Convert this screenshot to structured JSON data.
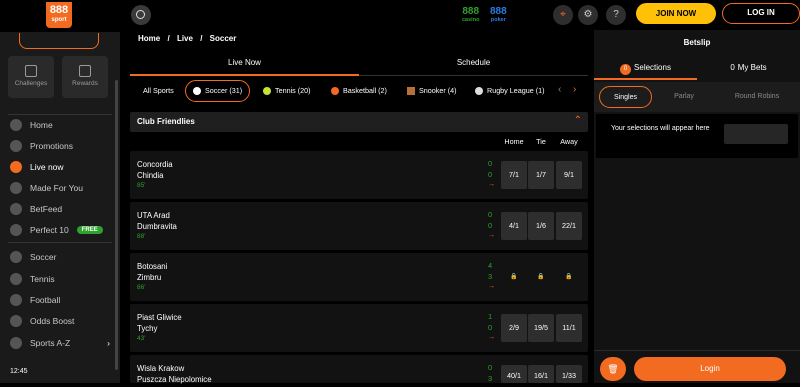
{
  "logo": {
    "number": "888",
    "sub": "sport"
  },
  "sidebar": {
    "tiles": [
      {
        "label": "Challenges",
        "icon": "shirt-icon"
      },
      {
        "label": "Rewards",
        "icon": "gift-icon"
      }
    ],
    "items": [
      {
        "label": "Home",
        "icon": "home-icon"
      },
      {
        "label": "Promotions",
        "icon": "megaphone-icon"
      },
      {
        "label": "Live now",
        "icon": "live-icon"
      },
      {
        "label": "Made For You",
        "icon": "thumbs-up-icon"
      },
      {
        "label": "BetFeed",
        "icon": "feed-icon"
      },
      {
        "label": "Perfect 10",
        "icon": "target-icon",
        "badge": "FREE"
      },
      {
        "label": "Soccer",
        "icon": "soccer-icon"
      },
      {
        "label": "Tennis",
        "icon": "tennis-icon"
      },
      {
        "label": "Football",
        "icon": "football-icon"
      },
      {
        "label": "Odds Boost",
        "icon": "boost-icon"
      },
      {
        "label": "Sports A-Z",
        "icon": "dots-icon"
      }
    ],
    "clock": "12:45"
  },
  "topbar": {
    "casino": {
      "number": "888",
      "label": "casino",
      "color": "#2ea12e"
    },
    "poker": {
      "number": "888",
      "label": "poker",
      "color": "#2b7be4"
    },
    "join_label": "JOIN NOW",
    "login_label": "LOG IN",
    "help": "?"
  },
  "breadcrumb": [
    "Home",
    "/",
    "Live",
    "/",
    "Soccer"
  ],
  "tabs": [
    "Live Now",
    "Schedule"
  ],
  "sports": [
    {
      "label": "All Sports",
      "icon": ""
    },
    {
      "label": "Soccer (31)",
      "icon": "soccer-icon",
      "color": "#ffffff"
    },
    {
      "label": "Tennis (20)",
      "icon": "tennis-icon",
      "color": "#c7e13a"
    },
    {
      "label": "Basketball (2)",
      "icon": "basketball-icon",
      "color": "#f26b21"
    },
    {
      "label": "Snooker (4)",
      "icon": "snooker-icon",
      "color": "#b5703a"
    },
    {
      "label": "Rugby League (1)",
      "icon": "rugby-icon",
      "color": "#dddddd"
    }
  ],
  "section": {
    "title": "Club Friendlies"
  },
  "columns": [
    "Home",
    "Tie",
    "Away"
  ],
  "matches": [
    {
      "home": "Concordia",
      "away": "Chindia",
      "minute": "85'",
      "score_home": "0",
      "score_away": "0",
      "odds": [
        "7/1",
        "1/7",
        "9/1"
      ]
    },
    {
      "home": "UTA Arad",
      "away": "Dumbravita",
      "minute": "88'",
      "score_home": "0",
      "score_away": "0",
      "odds": [
        "4/1",
        "1/6",
        "22/1"
      ]
    },
    {
      "home": "Botosani",
      "away": "Zimbru",
      "minute": "86'",
      "score_home": "4",
      "score_away": "3",
      "odds": [
        "🔒",
        "🔒",
        "🔒"
      ]
    },
    {
      "home": "Piast Gliwice",
      "away": "Tychy",
      "minute": "43'",
      "score_home": "1",
      "score_away": "0",
      "odds": [
        "2/9",
        "19/5",
        "11/1"
      ]
    },
    {
      "home": "Wisla Krakow",
      "away": "Puszcza Niepolomice",
      "minute": "",
      "score_home": "0",
      "score_away": "3",
      "odds": [
        "40/1",
        "16/1",
        "1/33"
      ]
    }
  ],
  "betslip": {
    "title": "Betslip",
    "tabs": [
      {
        "count": "0",
        "label": "Selections"
      },
      {
        "count": "0",
        "label": "My Bets"
      }
    ],
    "bet_types": [
      "Singles",
      "Parlay",
      "Round Robins"
    ],
    "empty_message": "Your selections will appear here",
    "login_label": "Login"
  },
  "colors": {
    "accent": "#f26b21",
    "live_green": "#2ea12e",
    "join_yellow": "#ffc107"
  }
}
